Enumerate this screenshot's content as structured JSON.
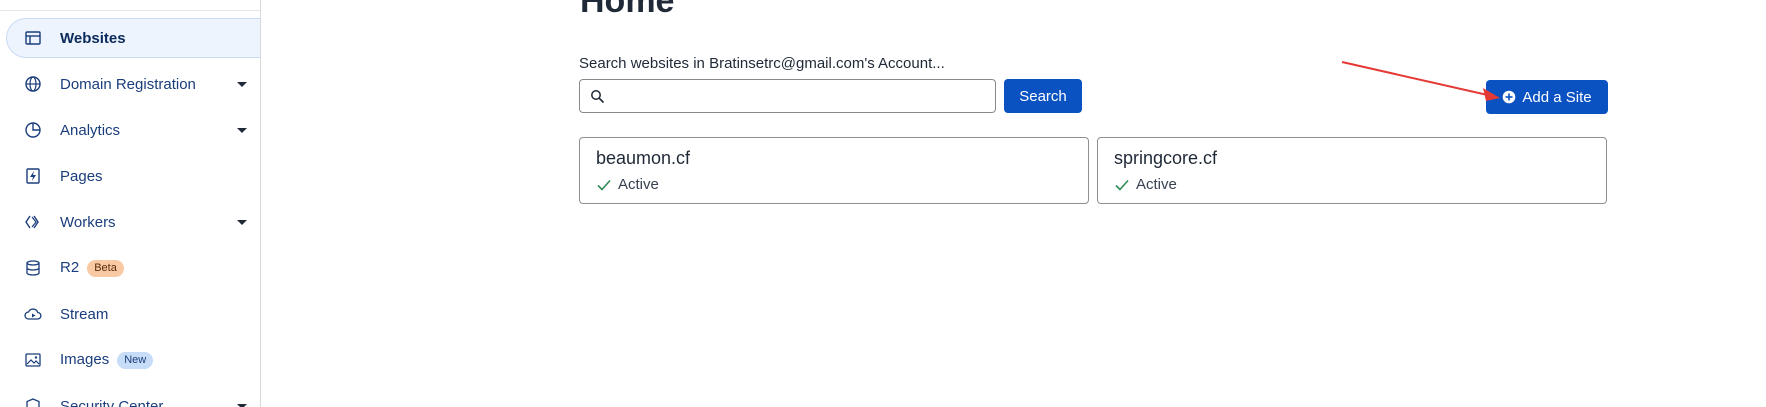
{
  "sidebar": {
    "items": [
      {
        "label": "Websites",
        "icon": "window-icon",
        "active": true,
        "has_caret": false,
        "badge": ""
      },
      {
        "label": "Domain Registration",
        "icon": "globe-icon",
        "active": false,
        "has_caret": true,
        "badge": ""
      },
      {
        "label": "Analytics",
        "icon": "pie-chart-icon",
        "active": false,
        "has_caret": true,
        "badge": ""
      },
      {
        "label": "Pages",
        "icon": "lightning-page-icon",
        "active": false,
        "has_caret": false,
        "badge": ""
      },
      {
        "label": "Workers",
        "icon": "workers-icon",
        "active": false,
        "has_caret": true,
        "badge": ""
      },
      {
        "label": "R2",
        "icon": "database-icon",
        "active": false,
        "has_caret": false,
        "badge": "Beta"
      },
      {
        "label": "Stream",
        "icon": "cloud-play-icon",
        "active": false,
        "has_caret": false,
        "badge": ""
      },
      {
        "label": "Images",
        "icon": "image-icon",
        "active": false,
        "has_caret": false,
        "badge": "New"
      },
      {
        "label": "Security Center",
        "icon": "shield-icon",
        "active": false,
        "has_caret": true,
        "badge": ""
      }
    ]
  },
  "main": {
    "title": "Home",
    "search_label": "Search websites in Bratinsetrc@gmail.com's Account...",
    "search_value": "",
    "search_button": "Search",
    "add_site_button": "Add a Site",
    "sites": [
      {
        "name": "beaumon.cf",
        "status": "Active"
      },
      {
        "name": "springcore.cf",
        "status": "Active"
      }
    ]
  },
  "colors": {
    "primary": "#0a51c2",
    "nav_text": "#1a3d7c",
    "active_bg": "#eef4fd",
    "status_green": "#2e8b57",
    "annotation_red": "#e53935"
  }
}
